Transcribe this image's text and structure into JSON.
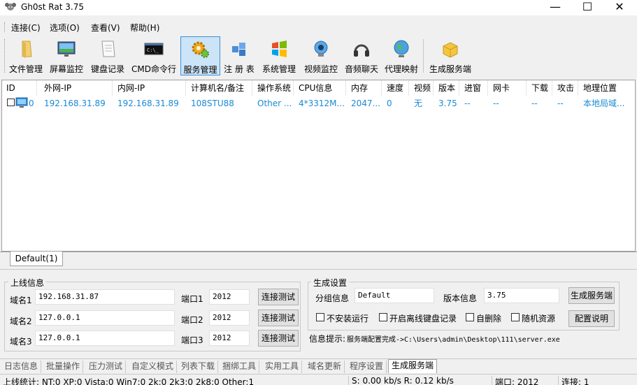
{
  "window": {
    "title": "Gh0st Rat 3.75",
    "minimize": "—",
    "maximize": "☐",
    "close": "✕"
  },
  "menu": [
    "连接(C)",
    "选项(O)",
    "查看(V)",
    "帮助(H)"
  ],
  "toolbar": [
    {
      "label": "文件管理",
      "icon": "folder-icon"
    },
    {
      "label": "屏幕监控",
      "icon": "monitor-icon"
    },
    {
      "label": "键盘记录",
      "icon": "keyboard-log-icon"
    },
    {
      "label": "CMD命令行",
      "icon": "cmd-icon"
    },
    {
      "label": "服务管理",
      "icon": "gears-icon"
    },
    {
      "label": "注 册 表",
      "icon": "registry-icon"
    },
    {
      "label": "系统管理",
      "icon": "windows-icon"
    },
    {
      "label": "视频监控",
      "icon": "webcam-icon"
    },
    {
      "label": "音频聊天",
      "icon": "headphones-icon"
    },
    {
      "label": "代理映射",
      "icon": "globe-icon"
    },
    {
      "label": "生成服务端",
      "icon": "package-icon"
    }
  ],
  "list": {
    "columns": [
      "ID",
      "外网-IP",
      "内网-IP",
      "计算机名/备注",
      "操作系统",
      "CPU信息",
      "内存",
      "速度",
      "视频",
      "版本",
      "进窗",
      "网卡",
      "下载",
      "攻击",
      "地理位置"
    ],
    "rows": [
      [
        "0",
        "192.168.31.89",
        "192.168.31.89",
        "108STU88",
        "Other ...",
        "4*3312M...",
        "2047...",
        "0",
        "无",
        "3.75",
        "--",
        "--",
        "--",
        "--",
        "本地局域..."
      ]
    ]
  },
  "group_tab": "Default(1)",
  "online": {
    "title": "上线信息",
    "domains": [
      {
        "label": "域名1",
        "value": "192.168.31.87",
        "port_label": "端口1",
        "port": "2012",
        "button": "连接测试"
      },
      {
        "label": "域名2",
        "value": "127.0.0.1",
        "port_label": "端口2",
        "port": "2012",
        "button": "连接测试"
      },
      {
        "label": "域名3",
        "value": "127.0.0.1",
        "port_label": "端口3",
        "port": "2012",
        "button": "连接测试"
      }
    ]
  },
  "build": {
    "title": "生成设置",
    "group_label": "分组信息",
    "group_value": "Default",
    "version_label": "版本信息",
    "version_value": "3.75",
    "build_button": "生成服务端",
    "config_button": "配置说明",
    "options": [
      "不安装运行",
      "开启离线键盘记录",
      "自删除",
      "随机资源"
    ],
    "info_label": "信息提示:",
    "info_text": "服务端配置完成->C:\\Users\\admin\\Desktop\\111\\server.exe"
  },
  "bottom_tabs": [
    "日志信息",
    "批量操作",
    "压力测试",
    "自定义模式",
    "列表下载",
    "捆绑工具",
    "实用工具",
    "域名更新",
    "程序设置",
    "生成服务端"
  ],
  "bottom_tab_active": 9,
  "status": {
    "stats": "上线统计: NT:0  XP:0  Vista:0  Win7:0  2k:0  2k3:0  2k8:0  Other:1",
    "speed": "S: 0.00 kb/s  R: 0.12 kb/s",
    "port": "端口: 2012",
    "connections": "连接: 1"
  },
  "colors": {
    "accent": "#1a8ad4",
    "toolbar_active_bg": "#cce4f7",
    "toolbar_active_border": "#3c8fd8"
  }
}
